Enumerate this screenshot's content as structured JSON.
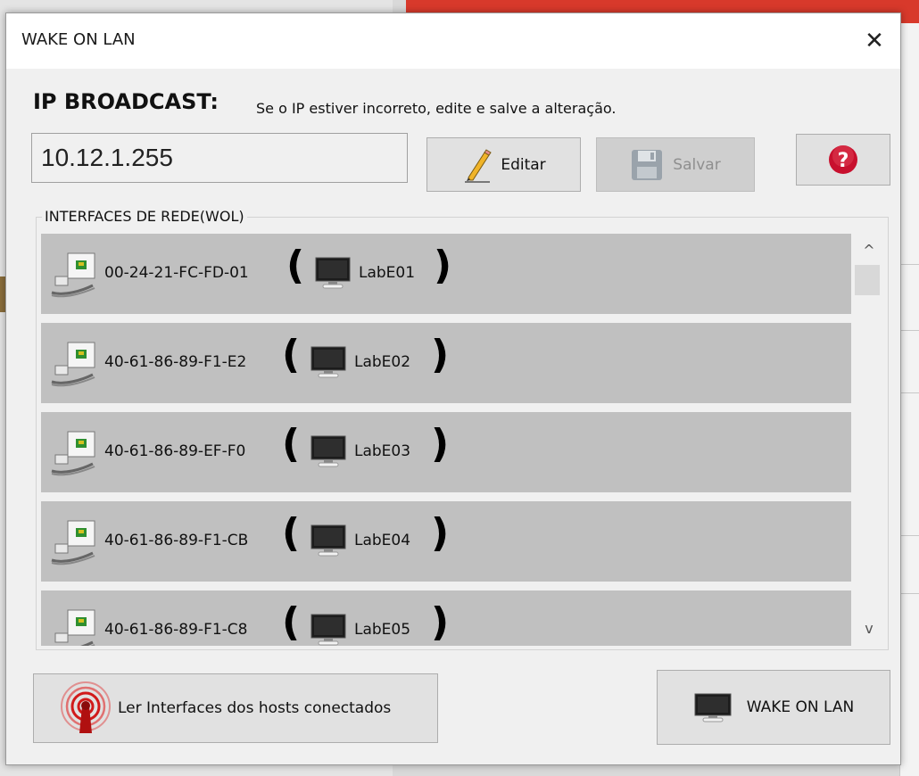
{
  "dialog": {
    "title": "WAKE ON LAN",
    "close_label": "✕"
  },
  "broadcast": {
    "heading": "IP BROADCAST:",
    "hint": "Se o IP estiver incorreto, edite e salve a alteração.",
    "ip_value": "10.12.1.255",
    "edit_label": "Editar",
    "save_label": "Salvar",
    "help_icon": "help-icon",
    "edit_icon": "pencil-icon",
    "save_icon": "floppy-disk-icon"
  },
  "interfaces": {
    "group_label": "INTERFACES DE REDE(WOL)",
    "rows": [
      {
        "mac": "00-24-21-FC-FD-01",
        "host": "LabE01"
      },
      {
        "mac": "40-61-86-89-F1-E2",
        "host": "LabE02"
      },
      {
        "mac": "40-61-86-89-EF-F0",
        "host": "LabE03"
      },
      {
        "mac": "40-61-86-89-F1-CB",
        "host": "LabE04"
      },
      {
        "mac": "40-61-86-89-F1-C8",
        "host": "LabE05"
      }
    ],
    "open_paren": "(",
    "close_paren": ")",
    "scroll_up": "^",
    "scroll_down": "v"
  },
  "footer": {
    "read_label": "Ler Interfaces dos hosts conectados",
    "wol_label": "WAKE ON LAN"
  },
  "colors": {
    "row_bg": "#c0c0c0",
    "dialog_bg": "#f0f0f0",
    "help_red": "#c8102e",
    "antenna_red": "#d11a1a"
  }
}
